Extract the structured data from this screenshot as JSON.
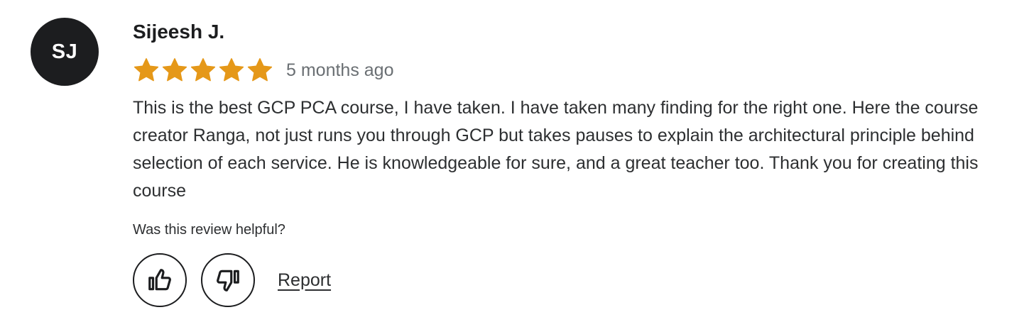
{
  "review": {
    "avatar_initials": "SJ",
    "reviewer_name": "Sijeesh J.",
    "rating": 5,
    "max_rating": 5,
    "star_color": "#e59819",
    "time_ago": "5 months ago",
    "text": "This is the best GCP PCA course, I have taken. I have taken many finding for the right one. Here the course creator Ranga, not just runs you through GCP but takes pauses to explain the architectural principle behind selection of each service. He is knowledgeable for sure, and a great teacher too. Thank you for creating this course",
    "helpful_question": "Was this review helpful?",
    "thumbs_up_icon": "thumbs-up-icon",
    "thumbs_down_icon": "thumbs-down-icon",
    "report_label": "Report"
  }
}
